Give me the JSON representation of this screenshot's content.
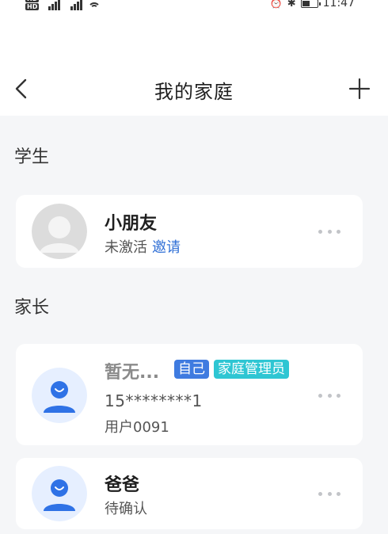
{
  "status_bar": {
    "time": "11:47",
    "hd1": "HD",
    "hd2": "HD",
    "net1": "4G",
    "net2": "4G"
  },
  "header": {
    "title": "我的家庭",
    "back_icon": "chevron-left-icon",
    "add_icon": "plus-icon"
  },
  "sections": {
    "students_label": "学生",
    "parents_label": "家长"
  },
  "student": {
    "name": "小朋友",
    "status": "未激活",
    "invite": "邀请"
  },
  "parent_self": {
    "name": "暂无...",
    "badge_self": "自己",
    "badge_admin": "家庭管理员",
    "phone": "15********1",
    "user": "用户0091"
  },
  "parent_dad": {
    "name": "爸爸",
    "status": "待确认"
  },
  "colors": {
    "accent": "#2f6fd6",
    "badge_self": "#3f7be0",
    "badge_admin": "#2ec6d3",
    "avatar_blue": "#2f72e6",
    "avatar_bg": "#e6efff"
  }
}
